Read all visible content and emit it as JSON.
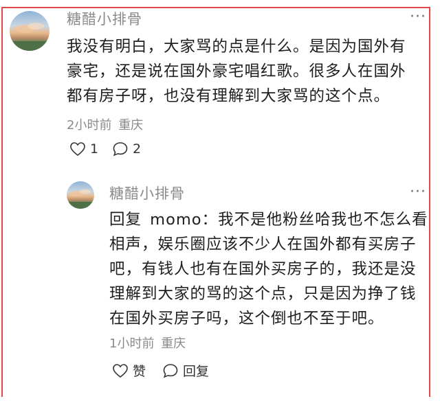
{
  "comment": {
    "author": "糖醋小排骨",
    "more_icon": "ellipsis-icon",
    "lines": [
      "我没有明白，大家骂的点是什么。是因为国外有",
      "豪宅，还是说在国外豪宅唱红歌。很多人在国外",
      "都有房子呀，也没有理解到大家骂的这个点。"
    ],
    "time": "2小时前",
    "location": "重庆",
    "likes": "1",
    "replies": "2"
  },
  "reply": {
    "author": "糖醋小排骨",
    "more_icon": "ellipsis-icon",
    "reply_prefix": "回复",
    "reply_target": "momo",
    "separator": "：",
    "first_line_rest": "我不是他粉丝哈我也不怎么看",
    "lines": [
      "相声，娱乐圈应该不少人在国外都有买房子",
      "吧，有钱人也有在国外买房子的，我还是没",
      "理解到大家的骂的这个点，只是因为挣了钱",
      "在国外买房子吗，这个倒也不至于吧。"
    ],
    "time": "1小时前",
    "location": "重庆",
    "like_label": "赞",
    "reply_label": "回复"
  },
  "colors": {
    "highlight_border": "#e04848",
    "meta_text": "#8a8a8a",
    "body_text": "#1e1e1e"
  }
}
